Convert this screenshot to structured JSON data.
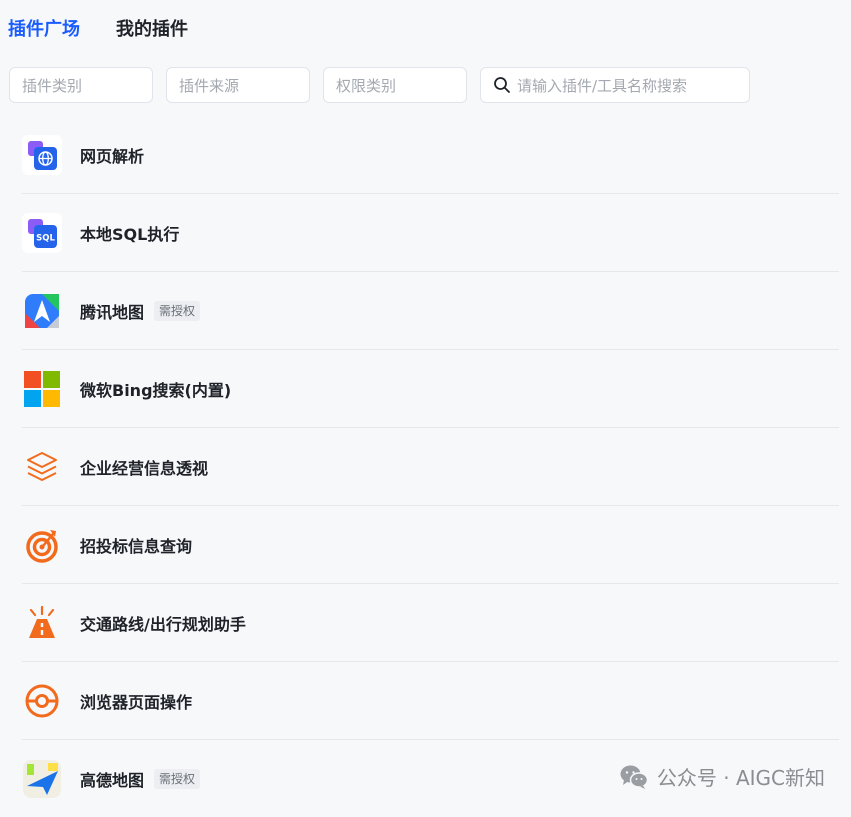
{
  "tabs": [
    {
      "label": "插件广场",
      "active": true
    },
    {
      "label": "我的插件",
      "active": false
    }
  ],
  "filters": {
    "category_placeholder": "插件类别",
    "source_placeholder": "插件来源",
    "permission_placeholder": "权限类别",
    "search_placeholder": "请输入插件/工具名称搜索"
  },
  "plugins": [
    {
      "name": "网页解析",
      "icon": "globe-web-icon"
    },
    {
      "name": "本地SQL执行",
      "icon": "sql-icon"
    },
    {
      "name": "腾讯地图",
      "icon": "tencent-map-icon",
      "badge": "需授权"
    },
    {
      "name": "微软Bing搜索(内置)",
      "icon": "microsoft-logo-icon"
    },
    {
      "name": "企业经营信息透视",
      "icon": "layers-icon"
    },
    {
      "name": "招投标信息查询",
      "icon": "target-icon"
    },
    {
      "name": "交通路线/出行规划助手",
      "icon": "road-icon"
    },
    {
      "name": "浏览器页面操作",
      "icon": "browser-icon"
    },
    {
      "name": "高德地图",
      "icon": "amap-icon",
      "badge": "需授权"
    }
  ],
  "watermark": {
    "text": "公众号 · AIGC新知"
  },
  "colors": {
    "accent": "#1a5cff",
    "orange": "#f26b1d"
  }
}
